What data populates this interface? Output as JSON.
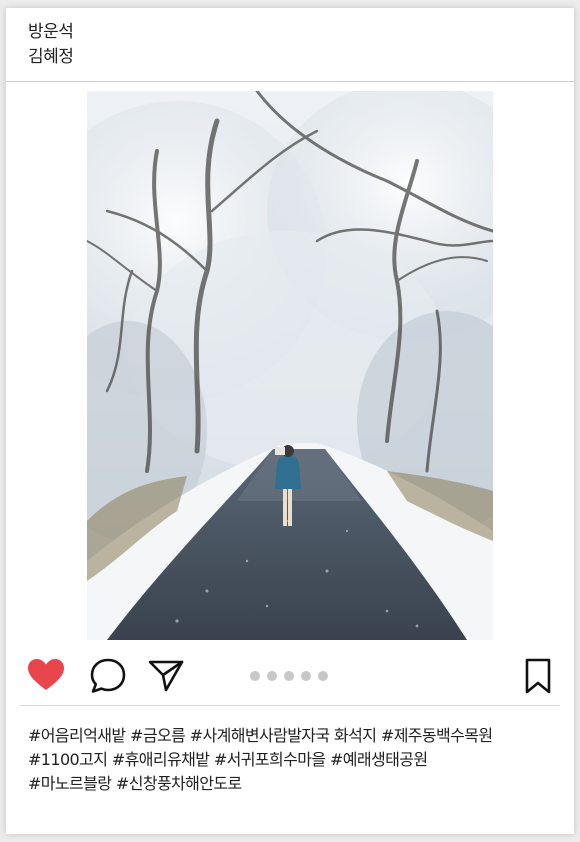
{
  "header": {
    "lines": [
      "방운석",
      "김혜정"
    ]
  },
  "photo": {
    "subject": "snowy-forest-road-photo"
  },
  "actions": {
    "like_color": "#e8454d",
    "icons": [
      "heart-icon",
      "comment-icon",
      "send-icon",
      "bookmark-icon"
    ]
  },
  "carousel": {
    "count": 5
  },
  "caption": {
    "lines": [
      "#어음리억새밭 #금오름 #사계해변사람발자국 화석지 #제주동백수목원",
      "#1100고지 #휴애리유채밭 #서귀포희수마을 #예래생태공원",
      "#마노르블랑 #신창풍차해안도로"
    ]
  }
}
